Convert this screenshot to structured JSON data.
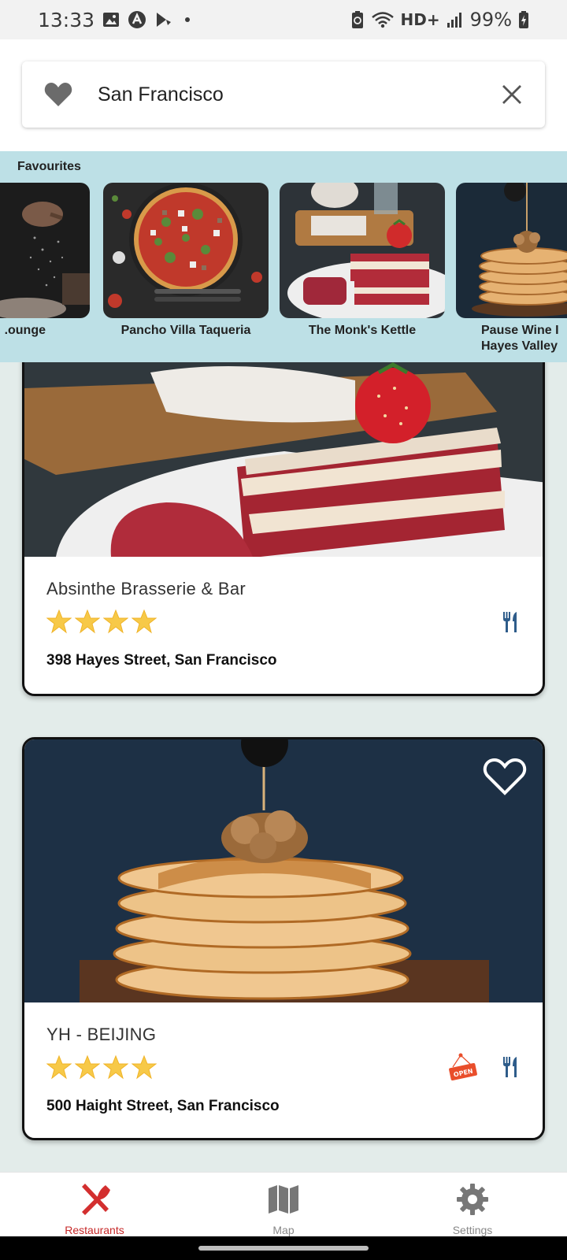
{
  "status_bar": {
    "time": "13:33",
    "network": "HD+",
    "battery": "99%"
  },
  "search": {
    "value": "San Francisco"
  },
  "favourites": {
    "title": "Favourites",
    "items": [
      {
        "label": ".ounge"
      },
      {
        "label": "Pancho Villa Taqueria"
      },
      {
        "label": "The Monk's Kettle"
      },
      {
        "label": "Pause Wine I",
        "label2": "Hayes Valley"
      }
    ]
  },
  "restaurants": [
    {
      "name": "Absinthe Brasserie & Bar",
      "rating": 4,
      "address": "398 Hayes Street, San Francisco",
      "open": false
    },
    {
      "name": "YH - BEIJING",
      "rating": 4,
      "address": "500 Haight Street, San Francisco",
      "open": true,
      "open_label": "OPEN"
    }
  ],
  "nav": {
    "restaurants": "Restaurants",
    "map": "Map",
    "settings": "Settings"
  },
  "colors": {
    "accent": "#c62828",
    "favourites_bg": "#bde0e6",
    "fork_icon": "#2e5c8a",
    "star": "#f7c948"
  }
}
